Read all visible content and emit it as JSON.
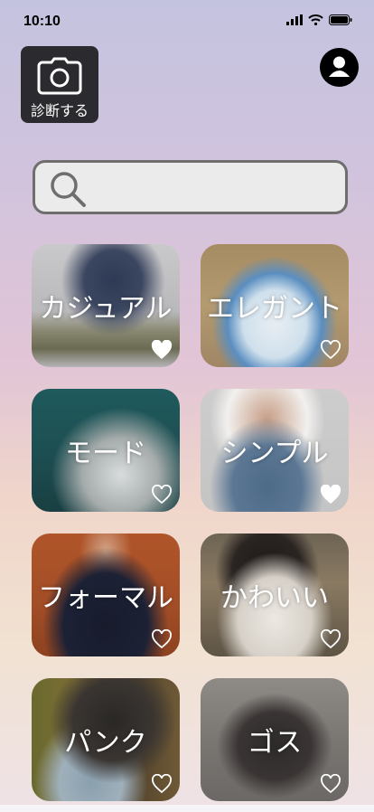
{
  "status": {
    "time": "10:10"
  },
  "diagnose": {
    "label": "診断する",
    "icon": "camera-icon"
  },
  "profile": {
    "icon": "user-icon"
  },
  "search": {
    "placeholder": "",
    "value": ""
  },
  "styles": [
    {
      "label": "カジュアル",
      "favorited": true
    },
    {
      "label": "エレガント",
      "favorited": false
    },
    {
      "label": "モード",
      "favorited": false
    },
    {
      "label": "シンプル",
      "favorited": true
    },
    {
      "label": "フォーマル",
      "favorited": false
    },
    {
      "label": "かわいい",
      "favorited": false
    },
    {
      "label": "パンク",
      "favorited": false
    },
    {
      "label": "ゴス",
      "favorited": false
    }
  ],
  "colors": {
    "button_dark": "#2b2a2e",
    "search_bg": "#ebebeb",
    "search_border": "#6e6e6e"
  }
}
